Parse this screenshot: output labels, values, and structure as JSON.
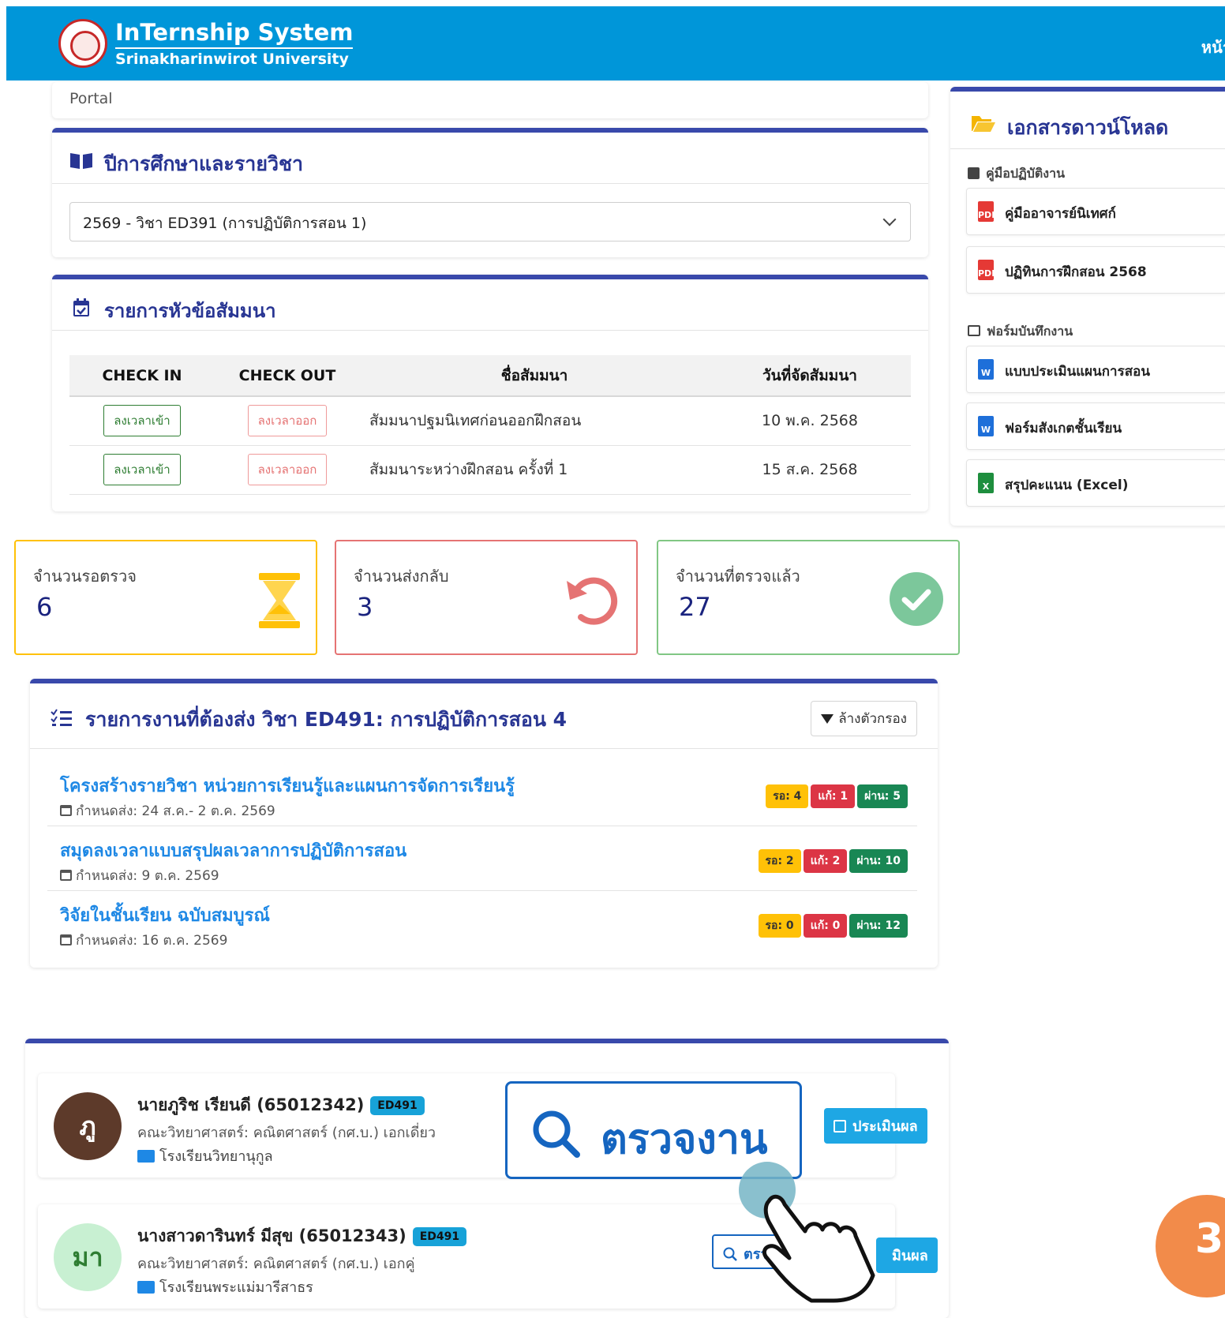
{
  "header": {
    "brand_title": "InTernship System",
    "brand_sub": "Srinakharinwirot University",
    "right_text": "หน้า"
  },
  "breadcrumb": {
    "text": "Portal"
  },
  "course_select": {
    "title": "ปีการศึกษาและรายวิชา",
    "selected": "2569 - วิชา ED391 (การปฏิบัติการสอน 1)"
  },
  "seminar": {
    "title": "รายการหัวข้อสัมมนา",
    "columns": [
      "CHECK IN",
      "CHECK OUT",
      "ชื่อสัมมนา",
      "วันที่จัดสัมมนา"
    ],
    "rows": [
      {
        "checkin": "ลงเวลาเข้า",
        "checkout": "ลงเวลาออก",
        "name": "สัมมนาปฐมนิเทศก่อนออกฝึกสอน",
        "date": "10 พ.ค. 2568"
      },
      {
        "checkin": "ลงเวลาเข้า",
        "checkout": "ลงเวลาออก",
        "name": "สัมมนาระหว่างฝึกสอน ครั้งที่ 1",
        "date": "15 ส.ค. 2568"
      }
    ]
  },
  "stats": {
    "pending": {
      "label": "จำนวนรอตรวจ",
      "value": "6",
      "color": "#ffc107"
    },
    "returned": {
      "label": "จำนวนส่งกลับ",
      "value": "3",
      "color": "#e57373"
    },
    "checked": {
      "label": "จำนวนที่ตรวจแล้ว",
      "value": "27",
      "color": "#81c784"
    }
  },
  "downloads": {
    "title": "เอกสารดาวน์โหลด",
    "manual_group": "คู่มือปฏิบัติงาน",
    "manuals": [
      {
        "label": "คู่มืออาจารย์นิเทศก์",
        "type": "pdf"
      },
      {
        "label": "ปฏิทินการฝึกสอน 2568",
        "type": "pdf"
      }
    ],
    "form_group": "ฟอร์มบันทึกงาน",
    "forms": [
      {
        "label": "แบบประเมินแผนการสอน",
        "type": "word"
      },
      {
        "label": "ฟอร์มสังเกตชั้นเรียน",
        "type": "word"
      },
      {
        "label": "สรุปคะแนน (Excel)",
        "type": "excel"
      }
    ]
  },
  "tasks": {
    "title": "รายการงานที่ต้องส่ง วิชา ED491: การปฏิบัติการสอน 4",
    "clear_filter": "ล้างตัวกรอง",
    "items": [
      {
        "title": "โครงสร้างรายวิชา หน่วยการเรียนรู้และแผนการจัดการเรียนรู้",
        "due": "กำหนดส่ง: 24 ส.ค.- 2 ต.ค. 2569",
        "wait": "รอ: 4",
        "fix": "แก้: 1",
        "pass": "ผ่าน: 5"
      },
      {
        "title": "สมุดลงเวลาแบบสรุปผลเวลาการปฏิบัติการสอน",
        "due": "กำหนดส่ง: 9 ต.ค. 2569",
        "wait": "รอ: 2",
        "fix": "แก้: 2",
        "pass": "ผ่าน: 10"
      },
      {
        "title": "วิจัยในชั้นเรียน ฉบับสมบูรณ์",
        "due": "กำหนดส่ง: 16 ต.ค. 2569",
        "wait": "รอ: 0",
        "fix": "แก้: 0",
        "pass": "ผ่าน: 12"
      }
    ]
  },
  "students": [
    {
      "initial": "ภู",
      "name": "นายภูริช เรียนดี (65012342)",
      "code": "ED491",
      "faculty": "คณะวิทยาศาสตร์: คณิตศาสตร์ (กศ.บ.) เอกเดี่ยว",
      "school": "โรงเรียนวิทยานุกูล",
      "avatar_color": "#5d3a2a",
      "avatar_text_color": "#ffffff"
    },
    {
      "initial": "มา",
      "name": "นางสาวดารินทร์ มีสุข (65012343)",
      "code": "ED491",
      "faculty": "คณะวิทยาศาสตร์: คณิตศาสตร์ (กศ.บ.) เอกคู่",
      "school": "โรงเรียนพระแม่มารีสาธร",
      "avatar_color": "#c8f0d2",
      "avatar_text_color": "#2e7d32"
    }
  ],
  "actions": {
    "check_big": "ตรวจงาน",
    "check_small": "ตรว",
    "evaluate": "ประเมินผล",
    "evaluate_partial": "มินผล"
  },
  "step_number": "3"
}
